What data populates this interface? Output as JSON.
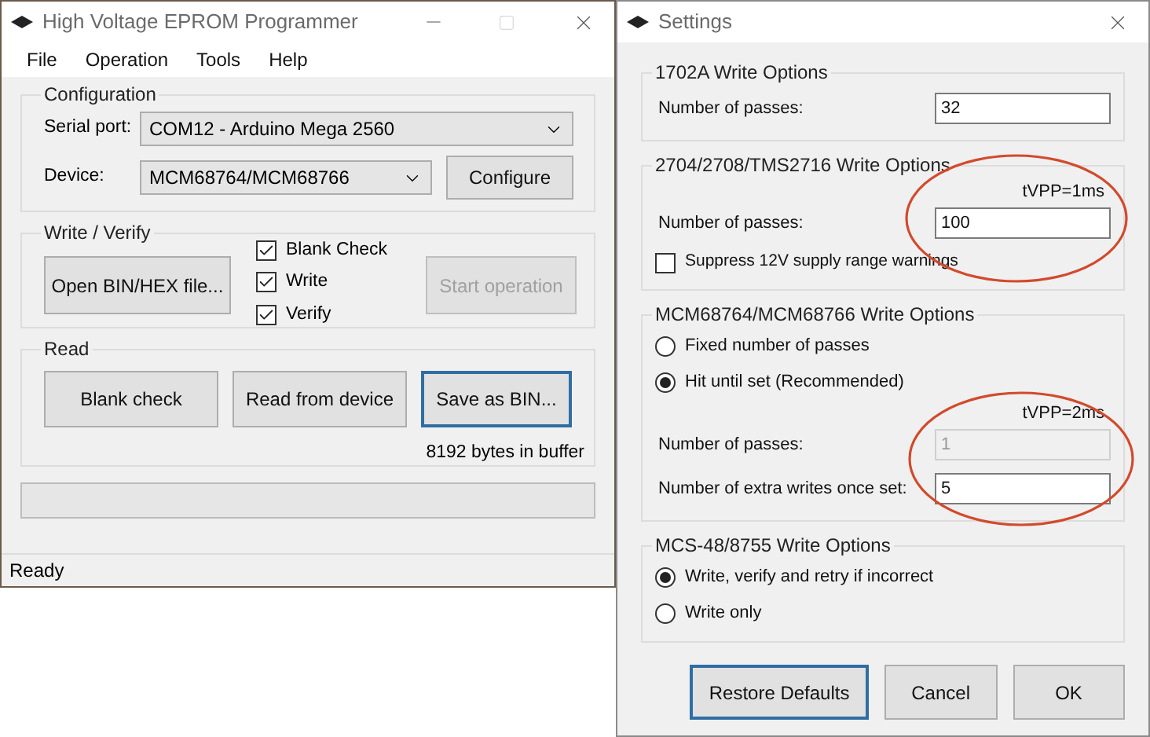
{
  "main_window": {
    "title": "High Voltage EPROM Programmer",
    "menu": [
      "File",
      "Operation",
      "Tools",
      "Help"
    ],
    "configuration": {
      "title": "Configuration",
      "serial_port": {
        "label": "Serial port:",
        "value": "COM12 - Arduino Mega 2560"
      },
      "device": {
        "label": "Device:",
        "value": "MCM68764/MCM68766"
      },
      "configure_button": "Configure"
    },
    "write_verify": {
      "title": "Write / Verify",
      "open_button": "Open BIN/HEX file...",
      "checks": [
        {
          "label": "Blank Check",
          "checked": true
        },
        {
          "label": "Write",
          "checked": true
        },
        {
          "label": "Verify",
          "checked": true
        }
      ],
      "start_button": {
        "label": "Start operation",
        "disabled": true
      }
    },
    "read": {
      "title": "Read",
      "buttons": [
        {
          "label": "Blank check",
          "focused": false
        },
        {
          "label": "Read from device",
          "focused": false
        },
        {
          "label": "Save as BIN...",
          "focused": true
        }
      ],
      "buffer_text": "8192 bytes in buffer"
    },
    "progress": {
      "level": 0
    },
    "status_bar": "Ready"
  },
  "settings_window": {
    "title": "Settings",
    "groups": [
      {
        "title": "1702A Write Options",
        "items": [
          {
            "kind": "field",
            "label": "Number of passes:",
            "value": "32",
            "disabled": false
          }
        ]
      },
      {
        "title": "2704/2708/TMS2716 Write Options",
        "note": "tVPP=1ms",
        "items": [
          {
            "kind": "field",
            "label": "Number of passes:",
            "value": "100",
            "disabled": false
          },
          {
            "kind": "checkbox",
            "label": "Suppress 12V supply range warnings",
            "checked": false
          }
        ]
      },
      {
        "title": "MCM68764/MCM68766 Write Options",
        "items": [
          {
            "kind": "radio",
            "label": "Fixed number of passes",
            "selected": false
          },
          {
            "kind": "radio",
            "label": "Hit until set (Recommended)",
            "selected": true
          },
          {
            "kind": "note",
            "label": "tVPP=2ms"
          },
          {
            "kind": "field",
            "label": "Number of passes:",
            "value": "1",
            "disabled": true
          },
          {
            "kind": "field",
            "label": "Number of extra writes once set:",
            "value": "5",
            "disabled": false
          }
        ]
      },
      {
        "title": "MCS-48/8755 Write Options",
        "items": [
          {
            "kind": "radio",
            "label": "Write, verify and retry if incorrect",
            "selected": true
          },
          {
            "kind": "radio",
            "label": "Write only",
            "selected": false
          }
        ]
      }
    ],
    "buttons": [
      {
        "label": "Restore Defaults",
        "focused": true
      },
      {
        "label": "Cancel",
        "focused": false
      },
      {
        "label": "OK",
        "focused": false
      }
    ]
  }
}
